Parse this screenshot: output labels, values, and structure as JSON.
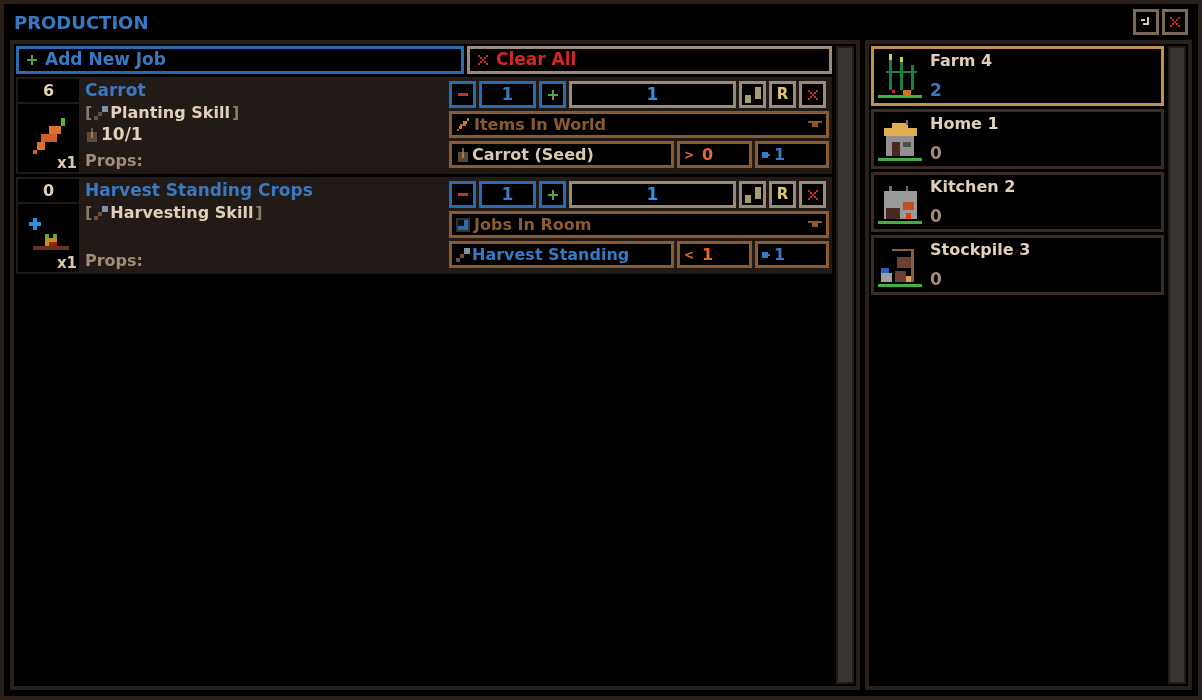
{
  "window": {
    "title": "PRODUCTION"
  },
  "add_button": {
    "label": "Add New Job"
  },
  "clear_button": {
    "label": "Clear All"
  },
  "jobs": [
    {
      "count": "6",
      "name": "Carrot",
      "skill_open": "[",
      "skill": "Planting Skill",
      "skill_close": "]",
      "kind": "crop",
      "stock": "10/1",
      "multiplier": "x1",
      "props": "Props:",
      "quantity": "1",
      "target": "1",
      "reset": "R",
      "source": {
        "kind": "items",
        "label": "Items In World"
      },
      "item": {
        "kind": "item",
        "label": "Carrot (Seed)"
      },
      "comparator": ">",
      "threshold": "0",
      "limit": "1"
    },
    {
      "count": "0",
      "name": "Harvest Standing Crops",
      "skill_open": "[",
      "skill": "Harvesting Skill",
      "skill_close": "]",
      "kind": "harvest",
      "multiplier": "x1",
      "props": "Props:",
      "quantity": "1",
      "target": "1",
      "reset": "R",
      "source": {
        "kind": "room",
        "label": "Jobs In Room"
      },
      "item": {
        "kind": "job",
        "label": "Harvest Standing"
      },
      "comparator": "<",
      "threshold": "1",
      "limit": "1"
    }
  ],
  "rooms": [
    {
      "kind": "farm",
      "name": "Farm 4",
      "count": "2",
      "selected": true
    },
    {
      "kind": "home",
      "name": "Home 1",
      "count": "0",
      "selected": false
    },
    {
      "kind": "kitchen",
      "name": "Kitchen 2",
      "count": "0",
      "selected": false
    },
    {
      "kind": "stockpile",
      "name": "Stockpile 3",
      "count": "0",
      "selected": false
    }
  ]
}
